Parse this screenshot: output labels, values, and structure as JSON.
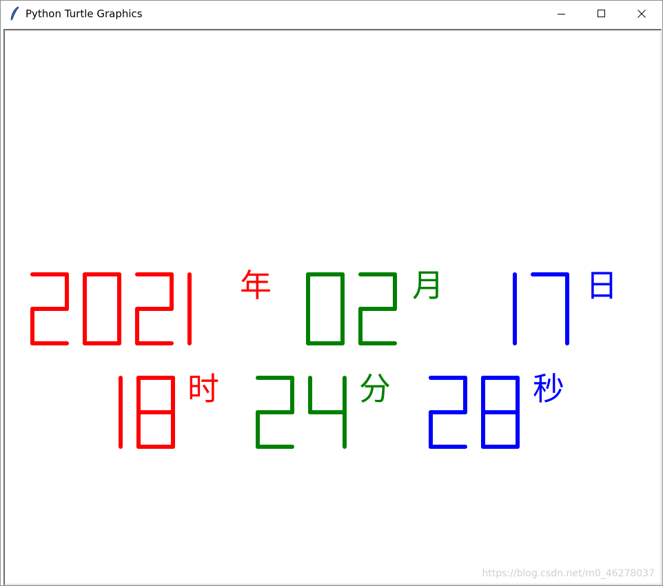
{
  "window": {
    "title": "Python Turtle Graphics",
    "icon": "feather-icon",
    "controls": {
      "minimize": "minimize-icon",
      "maximize": "maximize-icon",
      "close": "close-icon"
    }
  },
  "colors": {
    "red": "#ff0000",
    "green": "#008000",
    "blue": "#0000ff",
    "watermark": "#d0d0d0"
  },
  "clock": {
    "row1": [
      {
        "digits": "2021",
        "unit": "年",
        "color": "#ff0000"
      },
      {
        "digits": "02",
        "unit": "月",
        "color": "#008000"
      },
      {
        "digits": "17",
        "unit": "日",
        "color": "#0000ff"
      }
    ],
    "row2": [
      {
        "digits": "18",
        "unit": "时",
        "color": "#ff0000"
      },
      {
        "digits": "24",
        "unit": "分",
        "color": "#008000"
      },
      {
        "digits": "28",
        "unit": "秒",
        "color": "#0000ff"
      }
    ]
  },
  "watermark": "https://blog.csdn.net/m0_46278037"
}
